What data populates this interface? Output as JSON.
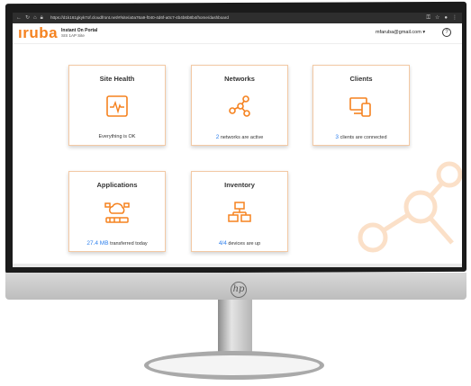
{
  "browser": {
    "url": "https://d1k161gkyk7of.cloudfront.net/#/site/a0a76a9-f040-4d6f-a0c7-4b4b6b8b4/home/dashboard"
  },
  "header": {
    "logo": "ıruba",
    "portal_title": "Instant On Portal",
    "site_name": "SIS 1AP Site",
    "user": "mfaruba@gmail.com ▾",
    "help": "?"
  },
  "cards": {
    "site_health": {
      "title": "Site Health",
      "status": "Everything is OK"
    },
    "networks": {
      "title": "Networks",
      "count": "2",
      "status_text": "networks are active"
    },
    "clients": {
      "title": "Clients",
      "count": "3",
      "status_text": "clients are connected"
    },
    "applications": {
      "title": "Applications",
      "count": "27.4 MB",
      "status_text": "transferred today"
    },
    "inventory": {
      "title": "Inventory",
      "count": "4/4",
      "status_text": "devices are up"
    }
  },
  "monitor": {
    "brand": "hp"
  },
  "colors": {
    "accent": "#f5821f",
    "ok": "#7cc142",
    "link": "#2f80ed",
    "card_border": "#f3c9a4"
  }
}
